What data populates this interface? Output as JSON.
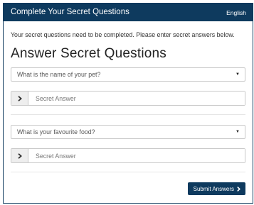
{
  "header": {
    "title": "Complete Your Secret Questions",
    "language": "English"
  },
  "intro_text": "Your secret questions need to be completed. Please enter secret answers below.",
  "page_title": "Answer Secret Questions",
  "questions": [
    {
      "question": "What is the name of your pet?",
      "answer_placeholder": "Secret Answer",
      "answer_value": ""
    },
    {
      "question": "What is your favourite food?",
      "answer_placeholder": "Secret Answer",
      "answer_value": ""
    }
  ],
  "submit_label": "Submit Answers",
  "icons": {
    "dropdown": "caret-down-icon",
    "addon": "chevron-right-icon",
    "submit": "chevron-right-icon"
  },
  "colors": {
    "brand": "#0e3a5e",
    "addon_bg": "#eeeeee",
    "border": "#c8c8c8"
  }
}
